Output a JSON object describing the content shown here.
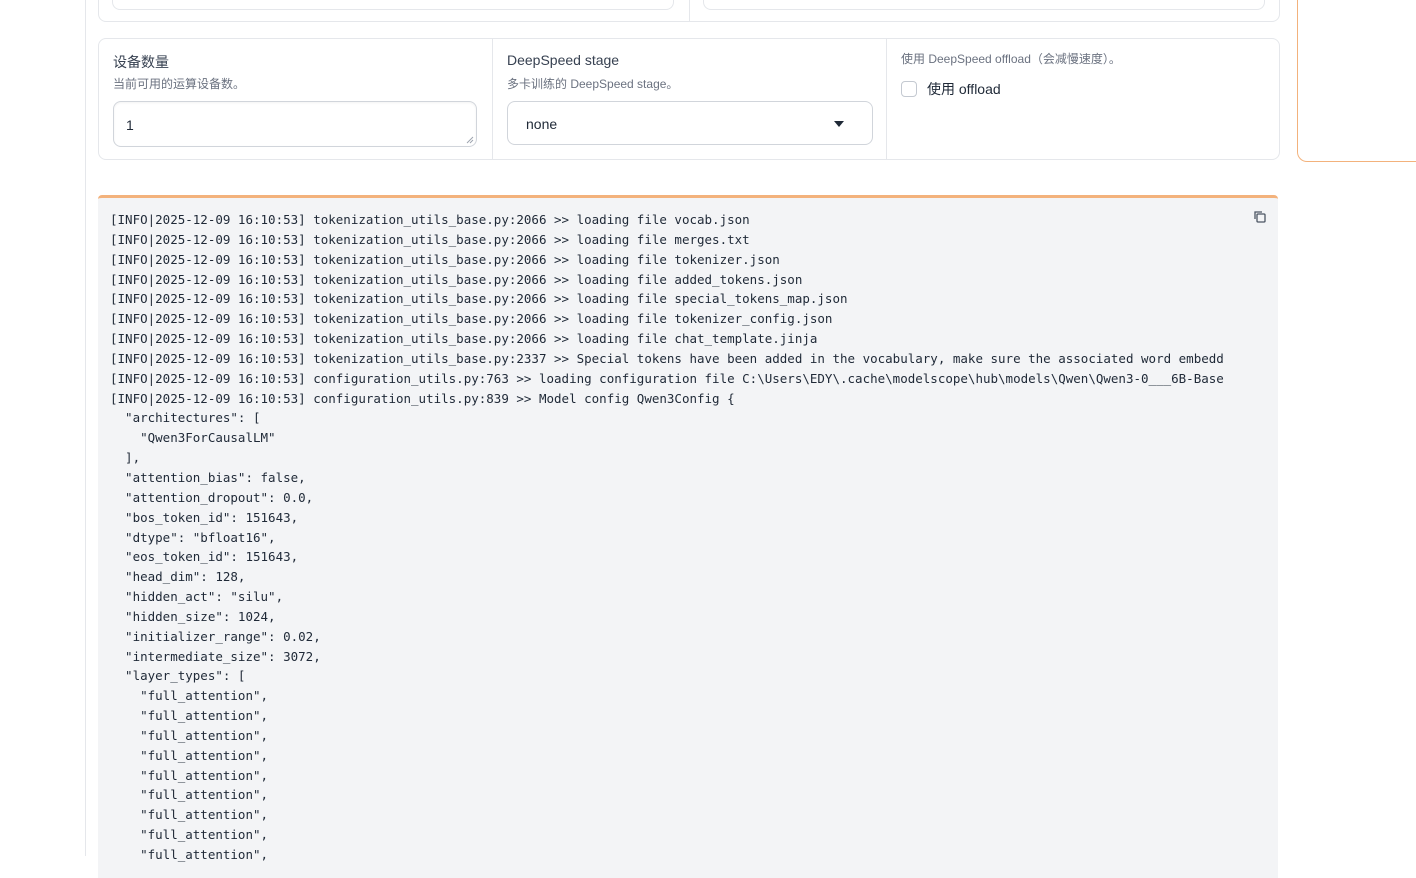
{
  "top_row": {},
  "settings": {
    "device_count": {
      "label": "设备数量",
      "info": "当前可用的运算设备数。",
      "value": "1"
    },
    "deepspeed_stage": {
      "label": "DeepSpeed stage",
      "info": "多卡训练的 DeepSpeed stage。",
      "value": "none"
    },
    "offload": {
      "info": "使用 DeepSpeed offload（会减慢速度）。",
      "checkbox_label": "使用 offload",
      "checked": false
    }
  },
  "log": {
    "text": "[INFO|2025-12-09 16:10:53] tokenization_utils_base.py:2066 >> loading file vocab.json\n[INFO|2025-12-09 16:10:53] tokenization_utils_base.py:2066 >> loading file merges.txt\n[INFO|2025-12-09 16:10:53] tokenization_utils_base.py:2066 >> loading file tokenizer.json\n[INFO|2025-12-09 16:10:53] tokenization_utils_base.py:2066 >> loading file added_tokens.json\n[INFO|2025-12-09 16:10:53] tokenization_utils_base.py:2066 >> loading file special_tokens_map.json\n[INFO|2025-12-09 16:10:53] tokenization_utils_base.py:2066 >> loading file tokenizer_config.json\n[INFO|2025-12-09 16:10:53] tokenization_utils_base.py:2066 >> loading file chat_template.jinja\n[INFO|2025-12-09 16:10:53] tokenization_utils_base.py:2337 >> Special tokens have been added in the vocabulary, make sure the associated word embedd\n[INFO|2025-12-09 16:10:53] configuration_utils.py:763 >> loading configuration file C:\\Users\\EDY\\.cache\\modelscope\\hub\\models\\Qwen\\Qwen3-0___6B-Base\n[INFO|2025-12-09 16:10:53] configuration_utils.py:839 >> Model config Qwen3Config {\n  \"architectures\": [\n    \"Qwen3ForCausalLM\"\n  ],\n  \"attention_bias\": false,\n  \"attention_dropout\": 0.0,\n  \"bos_token_id\": 151643,\n  \"dtype\": \"bfloat16\",\n  \"eos_token_id\": 151643,\n  \"head_dim\": 128,\n  \"hidden_act\": \"silu\",\n  \"hidden_size\": 1024,\n  \"initializer_range\": 0.02,\n  \"intermediate_size\": 3072,\n  \"layer_types\": [\n    \"full_attention\",\n    \"full_attention\",\n    \"full_attention\",\n    \"full_attention\",\n    \"full_attention\",\n    \"full_attention\",\n    \"full_attention\",\n    \"full_attention\",\n    \"full_attention\","
  },
  "icons": {
    "copy": "copy-icon",
    "dropdown": "chevron-down-icon"
  },
  "colors": {
    "accent_orange": "#f3b27c",
    "border": "#e5e7eb",
    "log_background": "#f3f4f6"
  }
}
